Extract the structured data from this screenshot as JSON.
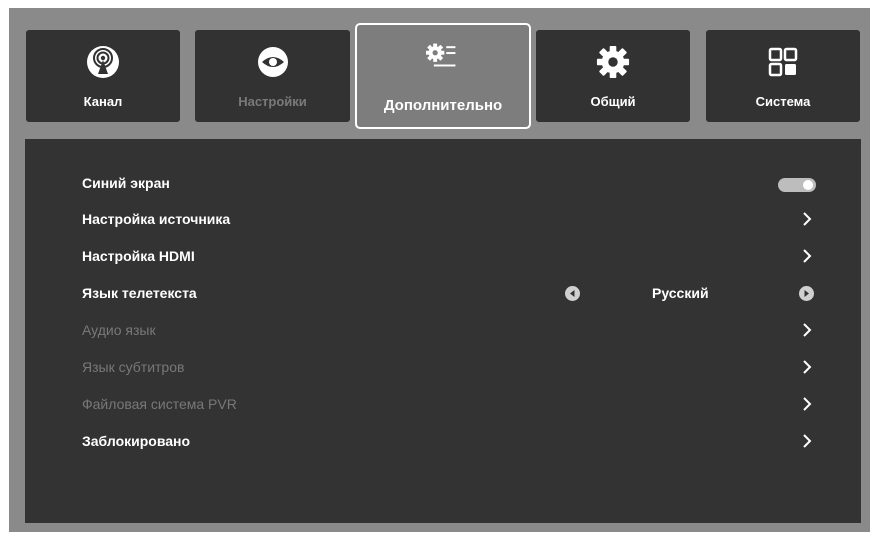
{
  "tabs": [
    {
      "label": "Канал",
      "icon": "antenna-icon",
      "state": "normal"
    },
    {
      "label": "Настройки",
      "icon": "eye-icon",
      "state": "disabled"
    },
    {
      "label": "Дополнительно",
      "icon": "gear-list-icon",
      "state": "selected"
    },
    {
      "label": "Общий",
      "icon": "gear-icon",
      "state": "normal"
    },
    {
      "label": "Система",
      "icon": "grid-icon",
      "state": "normal"
    }
  ],
  "menu": {
    "blue_screen": {
      "label": "Синий экран",
      "toggle": "on"
    },
    "source_setup": {
      "label": "Настройка источника"
    },
    "hdmi_setup": {
      "label": "Настройка HDMI"
    },
    "teletext_language": {
      "label": "Язык телетекста",
      "value": "Русский"
    },
    "audio_language": {
      "label": "Аудио язык",
      "state": "disabled"
    },
    "subtitle_language": {
      "label": "Язык субтитров",
      "state": "disabled"
    },
    "pvr_filesystem": {
      "label": "Файловая система PVR",
      "state": "disabled"
    },
    "locked": {
      "label": "Заблокировано"
    }
  },
  "colors": {
    "background": "#8a8a8a",
    "panel": "#333333",
    "tab": "#323232",
    "tab_active": "#7d7d7d",
    "text": "#ffffff",
    "text_disabled": "#787878"
  }
}
